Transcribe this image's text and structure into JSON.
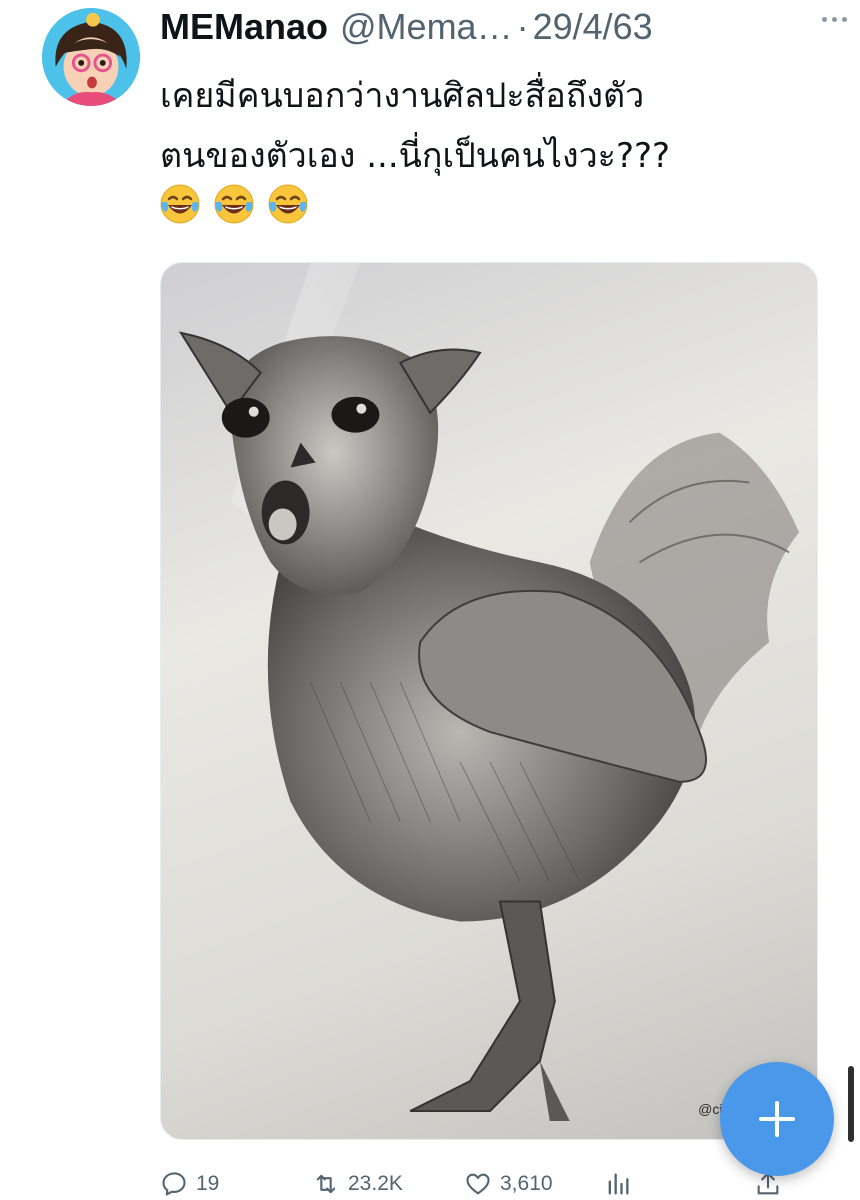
{
  "user": {
    "display_name": "MEManao",
    "handle": "@Mema…",
    "separator": "·",
    "date": "29/4/63",
    "avatar_icon": "avatar-cartoon-girl"
  },
  "tweet": {
    "lines": [
      "เคยมีคนบอกว่างานศิลปะสื่อถึงตัว",
      "ตนของตัวเอง ...นี่กุเป็นคนไงวะ???"
    ],
    "emojis": [
      "😂",
      "😂",
      "😂"
    ],
    "media_watermark": "@citr"
  },
  "actions": {
    "reply_count": "19",
    "retweet_count": "23.2K",
    "like_count": "3,610",
    "icons": [
      "reply-icon",
      "retweet-icon",
      "like-icon",
      "views-icon",
      "share-icon"
    ]
  },
  "fab": {
    "icon": "plus-icon",
    "color": "#4a98e9"
  },
  "colors": {
    "accent": "#4a98e9",
    "muted": "#536471",
    "text": "#0f1419"
  }
}
